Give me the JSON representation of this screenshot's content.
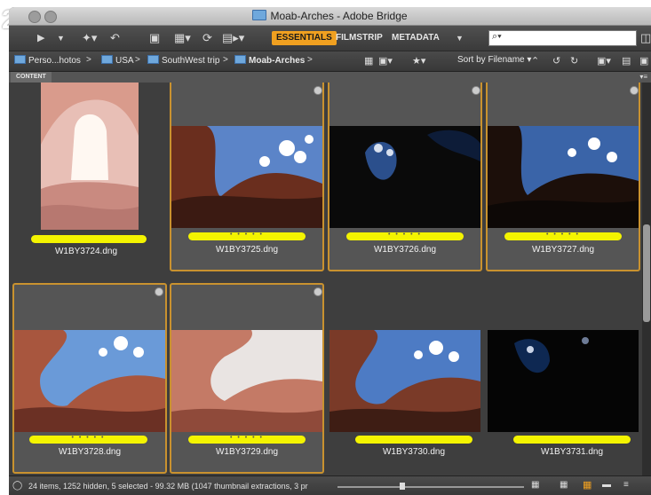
{
  "window": {
    "title": "Moab-Arches - Adobe Bridge",
    "step_number": "2"
  },
  "toolbar": {
    "workspaces": [
      {
        "label": "ESSENTIALS",
        "active": true
      },
      {
        "label": "FILMSTRIP",
        "active": false
      },
      {
        "label": "METADATA",
        "active": false
      }
    ],
    "search_placeholder": "⌕▾"
  },
  "path": {
    "crumbs": [
      "Perso...hotos",
      "USA",
      "SouthWest trip",
      "Moab-Arches"
    ],
    "sort_label": "Sort by Filename"
  },
  "panel": {
    "tab_label": "CONTENT"
  },
  "thumbnails": [
    {
      "filename": "W1BY3724.dng",
      "selected": false,
      "rating": ""
    },
    {
      "filename": "W1BY3725.dng",
      "selected": true,
      "rating": "• • • • •"
    },
    {
      "filename": "W1BY3726.dng",
      "selected": true,
      "rating": "• • • • •"
    },
    {
      "filename": "W1BY3727.dng",
      "selected": true,
      "rating": "• • • • •"
    },
    {
      "filename": "W1BY3728.dng",
      "selected": true,
      "rating": "• • • • •"
    },
    {
      "filename": "W1BY3729.dng",
      "selected": true,
      "rating": "• • • • •"
    },
    {
      "filename": "W1BY3730.dng",
      "selected": false,
      "rating": ""
    },
    {
      "filename": "W1BY3731.dng",
      "selected": false,
      "rating": ""
    }
  ],
  "status": {
    "text": "24 items, 1252 hidden, 5 selected - 99.32 MB (1047 thumbnail extractions, 3 pr"
  },
  "colors": {
    "accent": "#f0a020",
    "selection_border": "#c9922f",
    "label_yellow": "#f4f400"
  }
}
